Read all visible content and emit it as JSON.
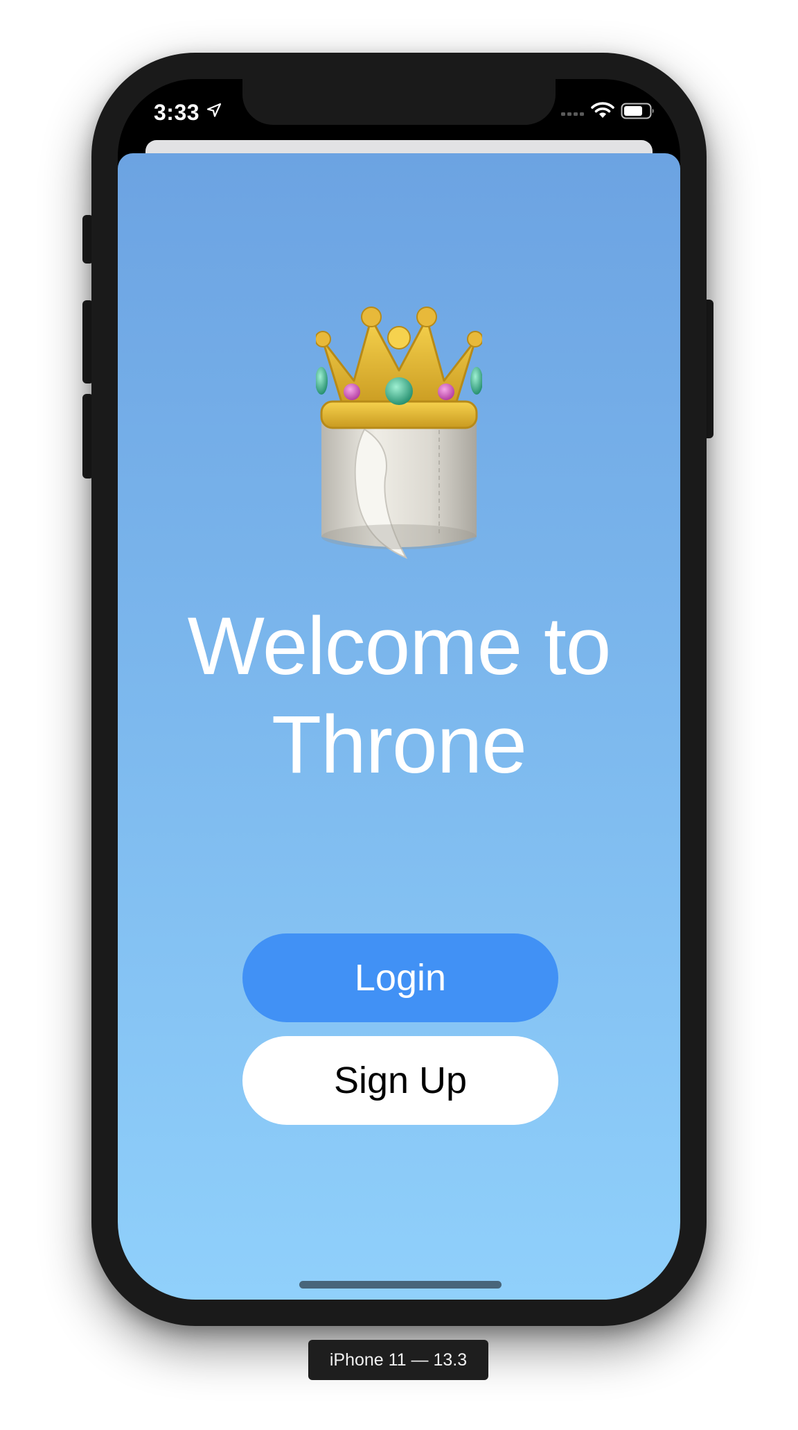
{
  "status_bar": {
    "time": "3:33",
    "location_icon": "location-arrow-icon",
    "signal_icon": "cellular-signal-icon",
    "wifi_icon": "wifi-icon",
    "battery_icon": "battery-icon"
  },
  "welcome": {
    "emoji": "crown-with-towel",
    "line1": "Welcome to",
    "line2": "Throne"
  },
  "buttons": {
    "login_label": "Login",
    "signup_label": "Sign Up"
  },
  "simulator": {
    "device_label": "iPhone 11 — 13.3"
  },
  "colors": {
    "gradient_top": "#6ca3e2",
    "gradient_bottom": "#90d0fb",
    "login_button": "#4191f5",
    "signup_button": "#ffffff",
    "device_frame": "#1a1a1a"
  }
}
